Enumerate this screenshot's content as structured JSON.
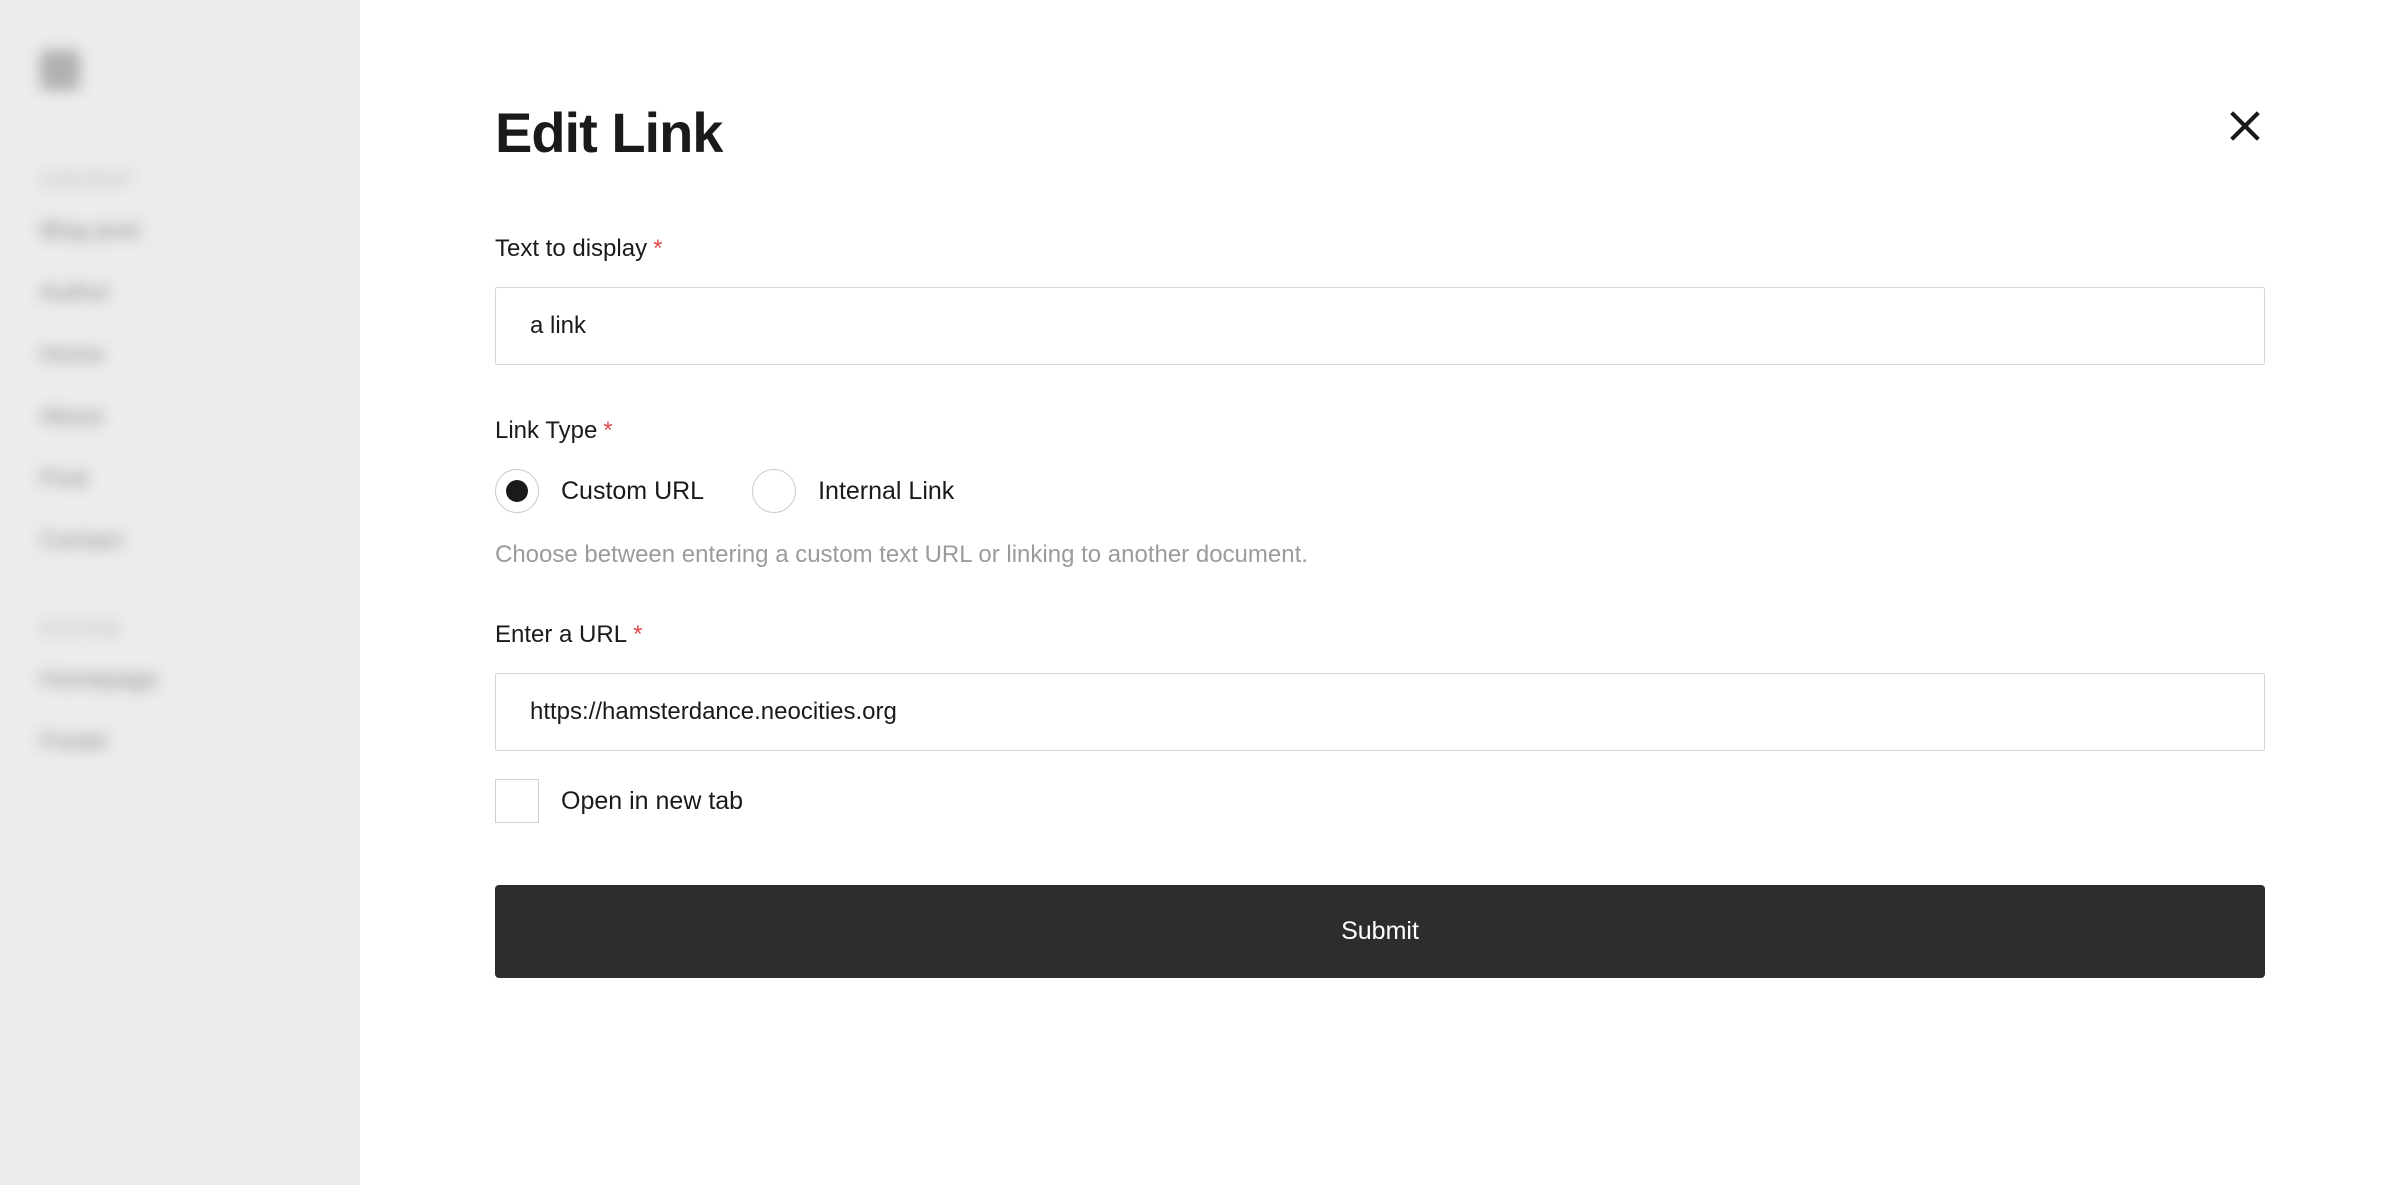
{
  "sidebar": {
    "section_label": "Content",
    "items": [
      "Blog post",
      "Author",
      "Home",
      "About",
      "Post",
      "Contact"
    ],
    "section2_label": "System",
    "items2": [
      "Homepage",
      "Footer"
    ]
  },
  "modal": {
    "title": "Edit Link",
    "fields": {
      "text_to_display": {
        "label": "Text to display",
        "value": "a link"
      },
      "link_type": {
        "label": "Link Type",
        "options": {
          "custom_url": "Custom URL",
          "internal_link": "Internal Link"
        },
        "selected": "custom_url",
        "help": "Choose between entering a custom text URL or linking to another document."
      },
      "enter_url": {
        "label": "Enter a URL",
        "value": "https://hamsterdance.neocities.org"
      },
      "open_new_tab": {
        "label": "Open in new tab",
        "checked": false
      }
    },
    "submit_label": "Submit"
  }
}
